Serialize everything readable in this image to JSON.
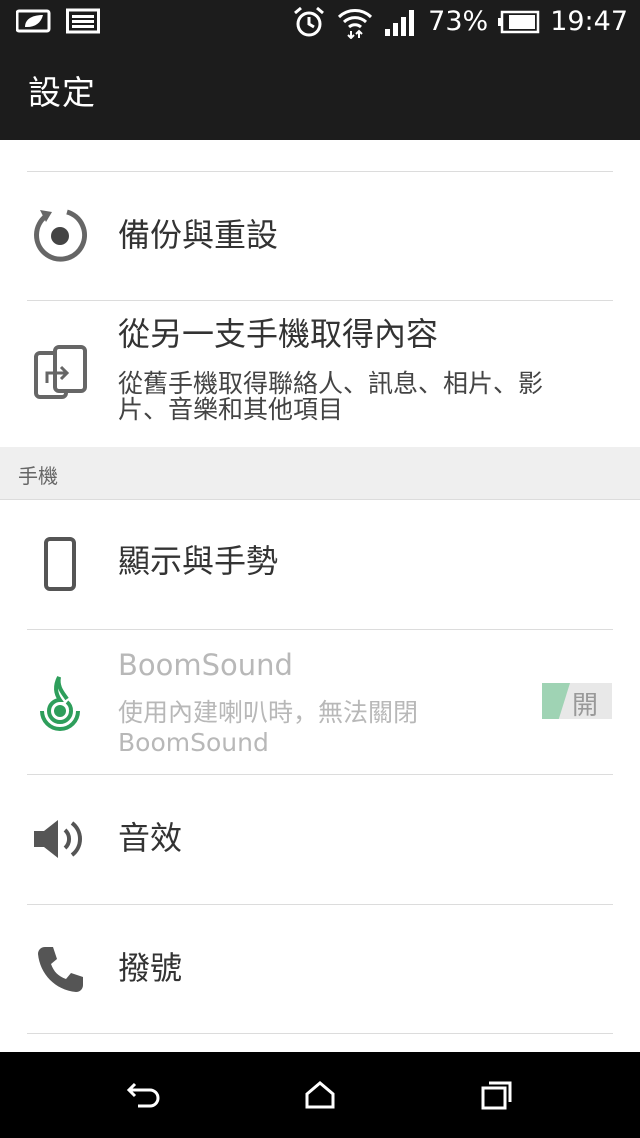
{
  "status_bar": {
    "battery_percent": "73%",
    "time": "19:47",
    "icons": [
      "leaf-battery-saver-icon",
      "image-notification-icon",
      "alarm-icon",
      "wifi-icon",
      "signal-icon",
      "battery-icon"
    ]
  },
  "header": {
    "title": "設定"
  },
  "list": {
    "backup": {
      "label": "備份與重設",
      "icon": "backup-restore-icon"
    },
    "transfer": {
      "label": "從另一支手機取得內容",
      "sub_line1": "從舊手機取得聯絡人、訊息、相片、影",
      "sub_line2": "片、音樂和其他項目",
      "icon": "phone-transfer-icon"
    },
    "section_phone": "手機",
    "display": {
      "label": "顯示與手勢",
      "icon": "phone-icon"
    },
    "boomsound": {
      "label": "BoomSound",
      "sub_line1": "使用內建喇叭時，無法關閉",
      "sub_line2": "BoomSound",
      "toggle": "開",
      "toggle_on": true,
      "icon": "boomsound-icon"
    },
    "sound": {
      "label": "音效",
      "icon": "speaker-icon"
    },
    "dial": {
      "label": "撥號",
      "icon": "phone-handset-icon"
    }
  },
  "colors": {
    "bar_bg": "#1c1c1c",
    "accent_green": "#2e9e5b"
  },
  "nav": {
    "icons": [
      "back-icon",
      "home-icon",
      "recent-apps-icon"
    ]
  }
}
